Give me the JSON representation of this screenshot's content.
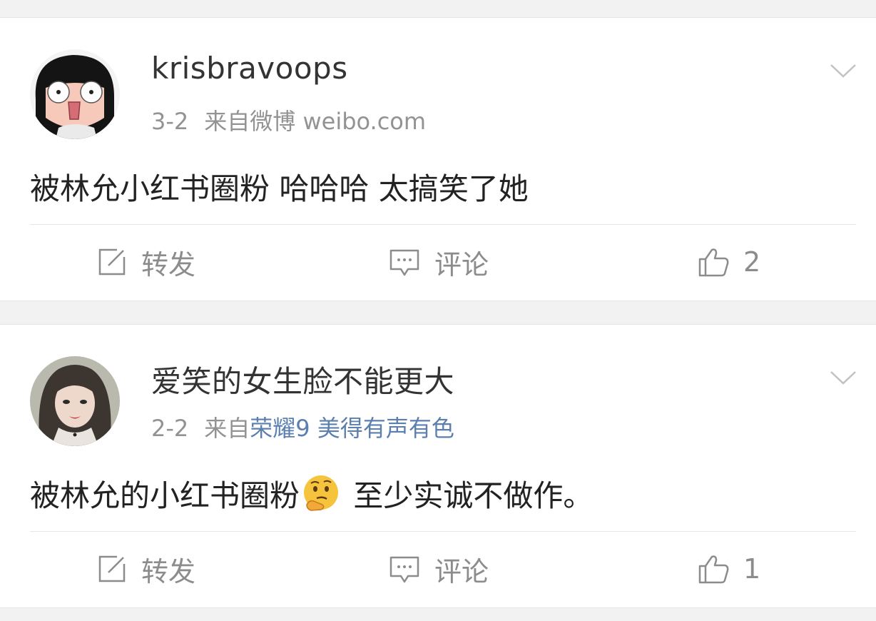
{
  "posts": [
    {
      "username": "krisbravoops",
      "date": "3-2",
      "source_prefix": "来自微博",
      "source_link": "weibo.com",
      "content_before_emoji": "被林允小红书圈粉 哈哈哈 太搞笑了她",
      "emoji_icon": "",
      "content_after_emoji": "",
      "actions": {
        "repost_label": "转发",
        "comment_label": "评论",
        "like_count": "2"
      }
    },
    {
      "username": "爱笑的女生脸不能更大",
      "date": "2-2",
      "source_prefix": "来自",
      "source_link": "荣耀9 美得有声有色",
      "content_before_emoji": "被林允的小红书圈粉",
      "emoji_icon": "thinking-face-emoji",
      "content_after_emoji": " 至少实诚不做作。",
      "actions": {
        "repost_label": "转发",
        "comment_label": "评论",
        "like_count": "1"
      }
    }
  ],
  "colors": {
    "background": "#f2f2f2",
    "card": "#ffffff",
    "text_primary": "#333333",
    "text_meta": "#939393",
    "link": "#5b7fae",
    "action": "#8c8c8c"
  },
  "icons": {
    "dropdown": "chevron-down-icon",
    "repost": "repost-edit-icon",
    "comment": "comment-bubble-icon",
    "like": "thumbs-up-icon"
  }
}
